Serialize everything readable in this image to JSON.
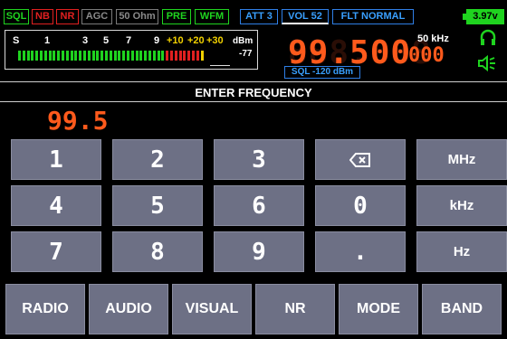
{
  "status": {
    "sql": "SQL",
    "nb": "NB",
    "nr": "NR",
    "agc": "AGC",
    "ohm": "50 Ohm",
    "pre": "PRE",
    "wfm": "WFM",
    "att": "ATT 3",
    "vol": "VOL 52",
    "flt": "FLT NORMAL",
    "battery": "3.97v"
  },
  "meter": {
    "s": "S",
    "t1": "1",
    "t3": "3",
    "t5": "5",
    "t7": "7",
    "t9": "9",
    "p10": "+10",
    "p20": "+20",
    "p30": "+30",
    "unit": "dBm",
    "reading": "-77"
  },
  "display": {
    "frequency": "99.500",
    "frequency_small": "000",
    "step": "50 kHz",
    "squelch": "SQL -120 dBm",
    "headphone_icon": "headphones-icon",
    "speaker_icon": "speaker-icon"
  },
  "entry": {
    "title": "ENTER FREQUENCY",
    "value": "99.5"
  },
  "keypad": {
    "k1": "1",
    "k2": "2",
    "k3": "3",
    "k4": "4",
    "k5": "5",
    "k6": "6",
    "k7": "7",
    "k8": "8",
    "k9": "9",
    "k0": "0",
    "dot": ".",
    "backspace_icon": "backspace-icon",
    "mhz": "MHz",
    "khz": "kHz",
    "hz": "Hz"
  },
  "nav": {
    "radio": "RADIO",
    "audio": "AUDIO",
    "visual": "VISUAL",
    "nr": "NR",
    "mode": "MODE",
    "band": "BAND"
  }
}
